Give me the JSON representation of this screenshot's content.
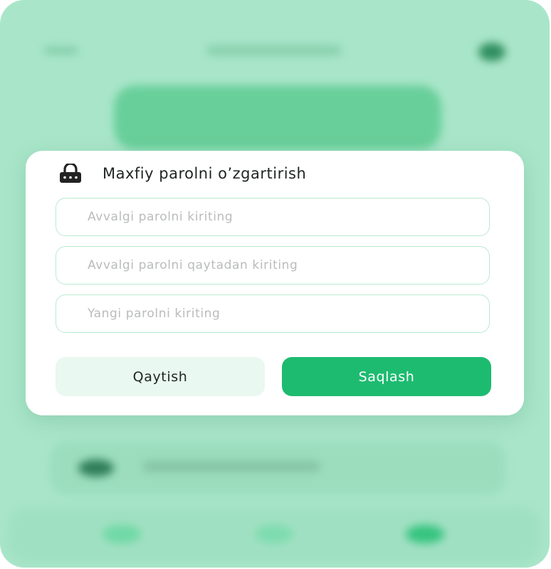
{
  "dialog": {
    "title": "Maxfiy parolni o’zgartirish",
    "fields": [
      {
        "placeholder": "Avvalgi parolni kiriting",
        "value": ""
      },
      {
        "placeholder": "Avvalgi parolni qaytadan kiriting",
        "value": ""
      },
      {
        "placeholder": "Yangi parolni kiriting",
        "value": ""
      }
    ],
    "back_label": "Qaytish",
    "save_label": "Saqlash"
  },
  "icons": {
    "lock": "lock-icon"
  },
  "colors": {
    "background": "#a9e6c9",
    "accent": "#1dbb70",
    "secondary_button": "#e9f8f1",
    "field_border": "#b9ead1"
  }
}
